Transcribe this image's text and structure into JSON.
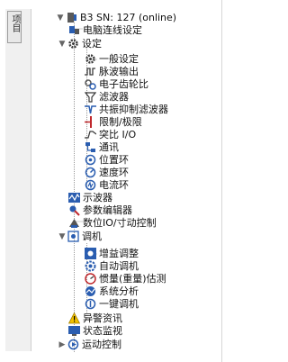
{
  "side_tab": {
    "label": "项目"
  },
  "tree": {
    "device": "B3 SN: 127 (online)",
    "connection_settings": "电脑连线设定",
    "settings": "设定",
    "general": "一般设定",
    "pulse_output": "脉波输出",
    "e_gear": "电子齿轮比",
    "filter": "滤波器",
    "resonance_filter": "共振抑制滤波器",
    "limit": "限制/极限",
    "ratio_io": "突比 I/O",
    "comm": "通讯",
    "position_loop": "位置环",
    "speed_loop": "速度环",
    "current_loop": "电流环",
    "oscilloscope": "示波器",
    "param_editor": "参数编辑器",
    "digital_io": "数位IO/寸动控制",
    "tuning": "调机",
    "gain_tuning": "增益调整",
    "auto_tuning": "自动调机",
    "inertia_est": "惯量(重量)估测",
    "system_analysis": "系统分析",
    "one_key_tuning": "一键调机",
    "alarm": "异警资讯",
    "status_monitor": "状态监视",
    "motion_control": "运动控制"
  },
  "colors": {
    "gear": "#3a3a3a",
    "blue": "#2a5db0",
    "red": "#c0282d",
    "yellow": "#f2c200",
    "tree_line": "#9a9a9a"
  }
}
